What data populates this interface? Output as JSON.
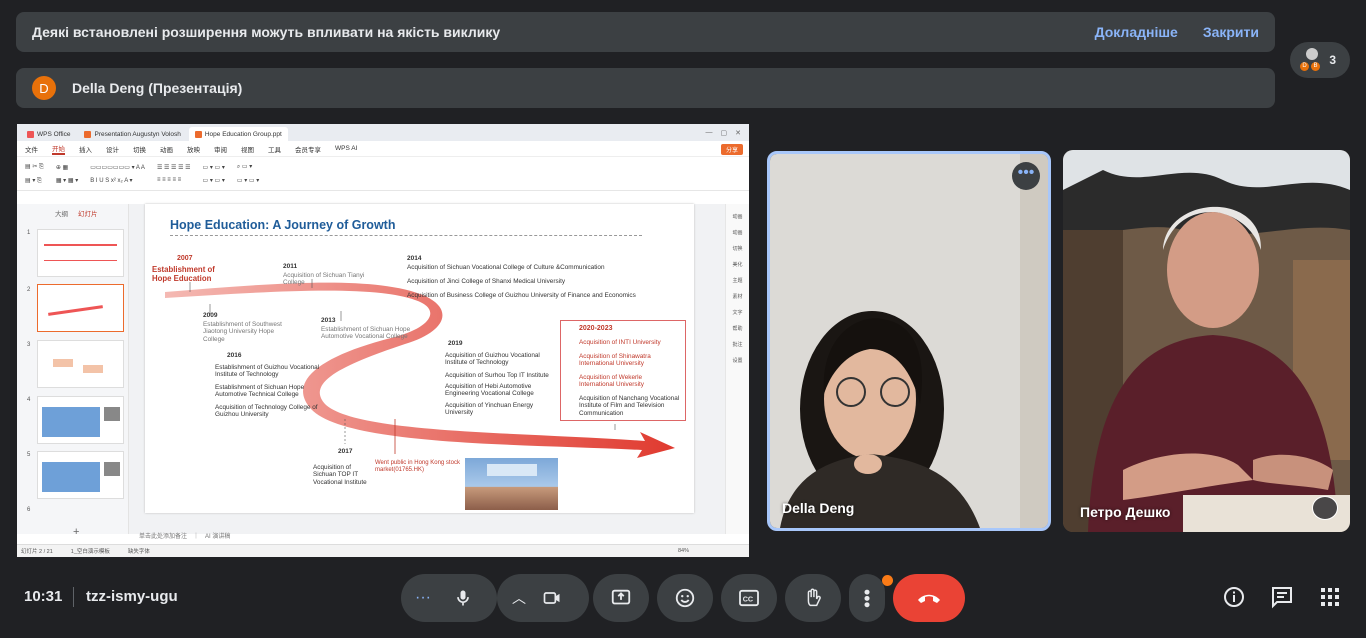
{
  "banner": {
    "message": "Деякі встановлені розширення можуть впливати на якість виклику",
    "learn_more": "Докладніше",
    "close": "Закрити"
  },
  "presenter": {
    "initial": "D",
    "label": "Della Deng (Презентація)"
  },
  "participants": {
    "count": "3"
  },
  "wps": {
    "tabs": [
      "WPS Office",
      "Presentation Augustyn Volosh",
      "Hope Education Group.ppt"
    ],
    "menu": [
      "文件",
      "开始",
      "插入",
      "设计",
      "切换",
      "动画",
      "放映",
      "审阅",
      "视图",
      "工具",
      "会员专享",
      "WPS AI"
    ],
    "share": "分享",
    "panel_tabs": [
      "大纲",
      "幻灯片"
    ],
    "slide_numbers": [
      "1",
      "2",
      "3",
      "4",
      "5",
      "6"
    ],
    "status_left": "幻灯片 2 / 21",
    "status_theme": "1_空白演示模板",
    "status_missing": "缺失字体",
    "status_zoom": "84%",
    "notes_placeholder": "单击此处添加备注",
    "ai_note": "AI 演讲稿",
    "right_tools": [
      "动画",
      "动画",
      "切换",
      "美化",
      "主题",
      "素材",
      "文字",
      "帮助",
      "批注",
      "设置"
    ]
  },
  "slide": {
    "title": "Hope Education: A Journey of Growth",
    "y2007": "2007",
    "y2007_text": "Establishment of Hope Education",
    "y2009": "2009",
    "y2009_text": "Establishment of Southwest Jiaotong University Hope College",
    "y2011": "2011",
    "y2011_text": "Acquisition of Sichuan Tianyi College",
    "y2013": "2013",
    "y2013_text": "Establishment of Sichuan Hope Automotive Vocational College",
    "y2014": "2014",
    "y2014_items": [
      "Acquisition of Sichuan Vocational College of Culture &Communication",
      "Acquisition of Jinci College of Shanxi Medical University",
      "Acquisition of Business College of Guizhou University of Finance and Economics"
    ],
    "y2016": "2016",
    "y2016_items": [
      "Establishment of Guizhou Vocational Institute of Technology",
      "Establishment of Sichuan Hope Automotive Technical College",
      "Acquisition of Technology College of Guizhou University"
    ],
    "y2017": "2017",
    "y2017_text": "Acquisition of Sichuan TOP IT Vocational Institute",
    "y2018_text": "Went public in Hong Kong stock market(01765.HK)",
    "y2019": "2019",
    "y2019_items": [
      "Acquisition of Guizhou Vocational Institute of Technology",
      "Acquisition of Surhou Top IT Institute",
      "Acquisition of Hebi Automotive Engineering Vocational College",
      "Acquisition of Yinchuan Energy University"
    ],
    "y2020": "2020-2023",
    "y2020_items": [
      "Acquisition of INTI University",
      "Acquisition of Shinawatra International University",
      "Acquisition of Wekerle International University",
      "Acquisition of Nanchang Vocational Institute of Film and Television Communication"
    ]
  },
  "tiles": {
    "della": "Della Deng",
    "petro": "Петро Дешко"
  },
  "footer": {
    "time": "10:31",
    "meeting_code": "tzz-ismy-ugu"
  },
  "colors": {
    "accent": "#8ab4f8",
    "hangup": "#ea4335",
    "notification": "#fa7b17",
    "wps_orange": "#ec6b2d"
  }
}
